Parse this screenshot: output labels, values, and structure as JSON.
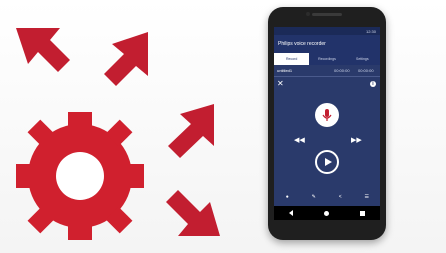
{
  "colors": {
    "accent_red": "#c21e30",
    "phone_body": "#1f1f1f",
    "app_bg": "#2a3a6b",
    "app_bar": "#22336a"
  },
  "app": {
    "status_time": "12:30",
    "title": "Philips voice recorder",
    "tabs": [
      {
        "label": "Record"
      },
      {
        "label": "Recordings"
      },
      {
        "label": "Settings"
      }
    ],
    "file": {
      "name": "untitled1",
      "elapsed": "00:00:00",
      "total": "00:00:00"
    }
  },
  "icons": {
    "close": "close-icon",
    "info": "info-icon",
    "mic": "microphone-icon",
    "rewind": "rewind-icon",
    "forward": "fast-forward-icon",
    "play": "play-icon",
    "bottom": [
      "index-icon",
      "edit-icon",
      "share-icon",
      "menu-icon"
    ],
    "nav": [
      "back-icon",
      "home-icon",
      "recent-apps-icon"
    ]
  }
}
